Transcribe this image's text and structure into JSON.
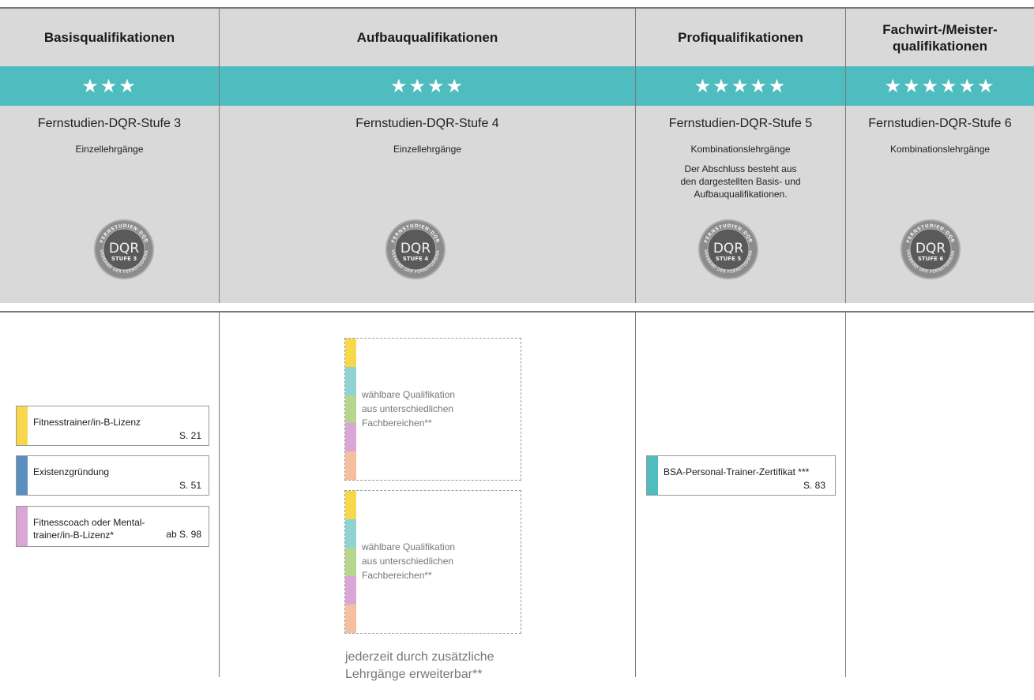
{
  "columns": [
    {
      "title": "Basisqualifikationen",
      "stars": "★★★",
      "stage": "Fernstudien-DQR-Stufe 3",
      "type": "Einzellehrgänge",
      "seal": {
        "top": "FERNSTUDIEN-DQR",
        "main": "DQR",
        "level": "STUFE 3",
        "bottom": "BUNDESVERBAND DER FERNSTUDIENANBIETER"
      }
    },
    {
      "title": "Aufbauqualifikationen",
      "stars": "★★★★",
      "stage": "Fernstudien-DQR-Stufe 4",
      "type": "Einzellehrgänge",
      "seal": {
        "top": "FERNSTUDIEN-DQR",
        "main": "DQR",
        "level": "STUFE 4",
        "bottom": "BUNDESVERBAND DER FERNSTUDIENANBIETER"
      }
    },
    {
      "title": "Profiqualifikationen",
      "stars": "★★★★★",
      "stage": "Fernstudien-DQR-Stufe 5",
      "type": "Kombinationslehrgänge",
      "note": "Der Abschluss besteht aus den dargestellten Basis- und Aufbauqualifikationen.",
      "seal": {
        "top": "FERNSTUDIEN-DQR",
        "main": "DQR",
        "level": "STUFE 5",
        "bottom": "BUNDESVERBAND DER FERNSTUDIENANBIETER"
      }
    },
    {
      "title": "Fachwirt-/Meister-qualifikationen",
      "stars": "★★★★★★",
      "stage": "Fernstudien-DQR-Stufe 6",
      "type": "Kombinationslehrgänge",
      "seal": {
        "top": "FERNSTUDIEN-DQR",
        "main": "DQR",
        "level": "STUFE 6",
        "bottom": "BUNDESVERBAND DER FERNSTUDIENANBIETER"
      }
    }
  ],
  "title_lines": {
    "c4a": "Fachwirt-/Meister-",
    "c4b": "qualifikationen"
  },
  "note_lines": [
    "Der Abschluss besteht aus",
    "den dargestellten Basis- und",
    "Aufbauqualifikationen."
  ],
  "courses": [
    {
      "title": "Fitnesstrainer/in-B-Lizenz",
      "page": "S. 21",
      "color": "#f7d84a"
    },
    {
      "title": "Existenzgründung",
      "page": "S. 51",
      "color": "#5b8fc2"
    },
    {
      "title_lines": [
        "Fitnesscoach oder Mental-",
        "trainer/in-B-Lizenz*"
      ],
      "page": "ab S. 98",
      "color": "#d9a6d6"
    }
  ],
  "elective": {
    "lines": [
      "wählbare Qualifikation",
      "aus unterschiedlichen",
      "Fachbereichen**"
    ],
    "colors": [
      "#f7d84a",
      "#8fd3d3",
      "#b5d68c",
      "#d9a6d6",
      "#f6c0a0"
    ]
  },
  "profi_course": {
    "title": "BSA-Personal-Trainer-Zertifikat ***",
    "page": "S. 83",
    "color": "#4fbcbf"
  },
  "footnote_lines": [
    "jederzeit durch zusätzliche",
    "Lehrgänge erweiterbar**"
  ],
  "colors": {
    "teal": "#4fbcbf",
    "header": "#d9d9d9",
    "rule": "#7a7a7a"
  }
}
